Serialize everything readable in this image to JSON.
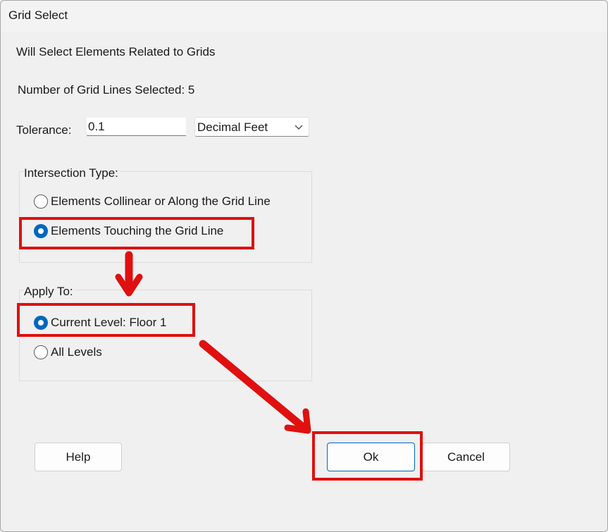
{
  "window": {
    "title": "Grid Select"
  },
  "header": {
    "description": "Will Select Elements Related to Grids",
    "count_text": "Number of Grid Lines Selected: 5"
  },
  "tolerance": {
    "label": "Tolerance:",
    "value": "0.1",
    "unit_selected": "Decimal Feet"
  },
  "intersection_type": {
    "label": "Intersection Type:",
    "options": [
      {
        "label": "Elements Collinear or Along the Grid Line",
        "checked": false
      },
      {
        "label": "Elements Touching the Grid Line",
        "checked": true
      }
    ]
  },
  "apply_to": {
    "label": "Apply To:",
    "options": [
      {
        "label": "Current Level: Floor 1",
        "checked": true
      },
      {
        "label": "All Levels",
        "checked": false
      }
    ]
  },
  "buttons": {
    "help": "Help",
    "ok": "Ok",
    "cancel": "Cancel"
  },
  "colors": {
    "accent": "#0067c0",
    "annotation": "#e01010"
  },
  "icons": {
    "dropdown": "chevron-down-icon",
    "annotation_arrows": "red-arrow-icon"
  }
}
